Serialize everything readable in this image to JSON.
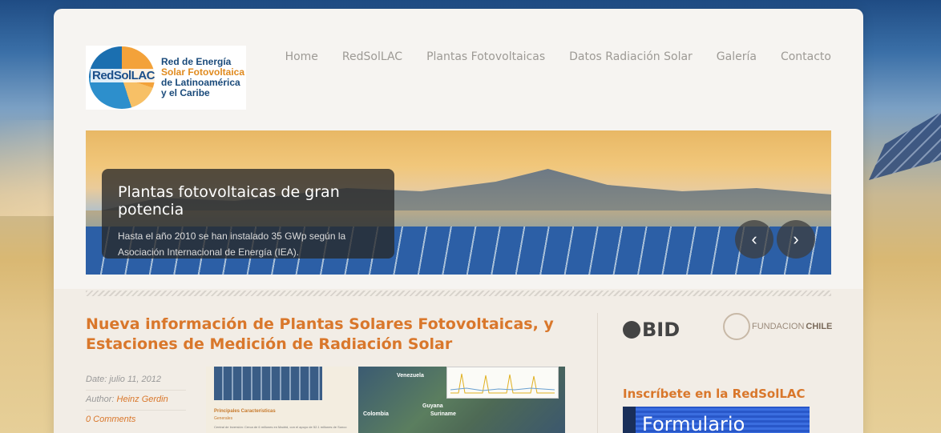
{
  "logo": {
    "abbr": "RedSolLAC",
    "line1": "Red de Energía",
    "line2": "Solar Fotovoltaica",
    "line3": "de Latinoamérica",
    "line4": "y el Caribe"
  },
  "nav": {
    "items": [
      {
        "label": "Home"
      },
      {
        "label": "RedSolLAC"
      },
      {
        "label": "Plantas Fotovoltaicas"
      },
      {
        "label": "Datos Radiación Solar"
      },
      {
        "label": "Galería"
      },
      {
        "label": "Contacto"
      }
    ]
  },
  "slider": {
    "title": "Plantas fotovoltaicas de gran potencia",
    "text": "Hasta el año 2010 se han instalado 35 GWp según la Asociación Internacional de Energía (IEA).",
    "prev_icon": "chevron-left-icon",
    "next_icon": "chevron-right-icon",
    "prev_glyph": "‹",
    "next_glyph": "›"
  },
  "post": {
    "title": "Nueva información de Plantas Solares Fotovoltaicas, y Estaciones de Medición de Radiación Solar",
    "date_label": "Date:",
    "date": "julio 11, 2012",
    "author_label": "Author:",
    "author": "Heinz Gerdin",
    "comments": "0 Comments",
    "image": {
      "heading": "Principales Características",
      "subheading": "Generales",
      "body": "Central de Inversión: Cerca de 6 millones en Madrid, con el apoyo de 52.1 millones de Sunco",
      "map_labels": [
        "Venezuela",
        "Guyana",
        "Suriname",
        "Colombia"
      ]
    }
  },
  "sidebar": {
    "bid_text": "BID",
    "fundacion_text_1": "FUNDACION",
    "fundacion_text_2": "CHILE",
    "heading": "Inscríbete en la RedSolLAC",
    "form_banner": "Formulario"
  },
  "colors": {
    "accent": "#d9772b",
    "nav_text": "#9d9a95",
    "page_bg": "#f6f4f1"
  }
}
